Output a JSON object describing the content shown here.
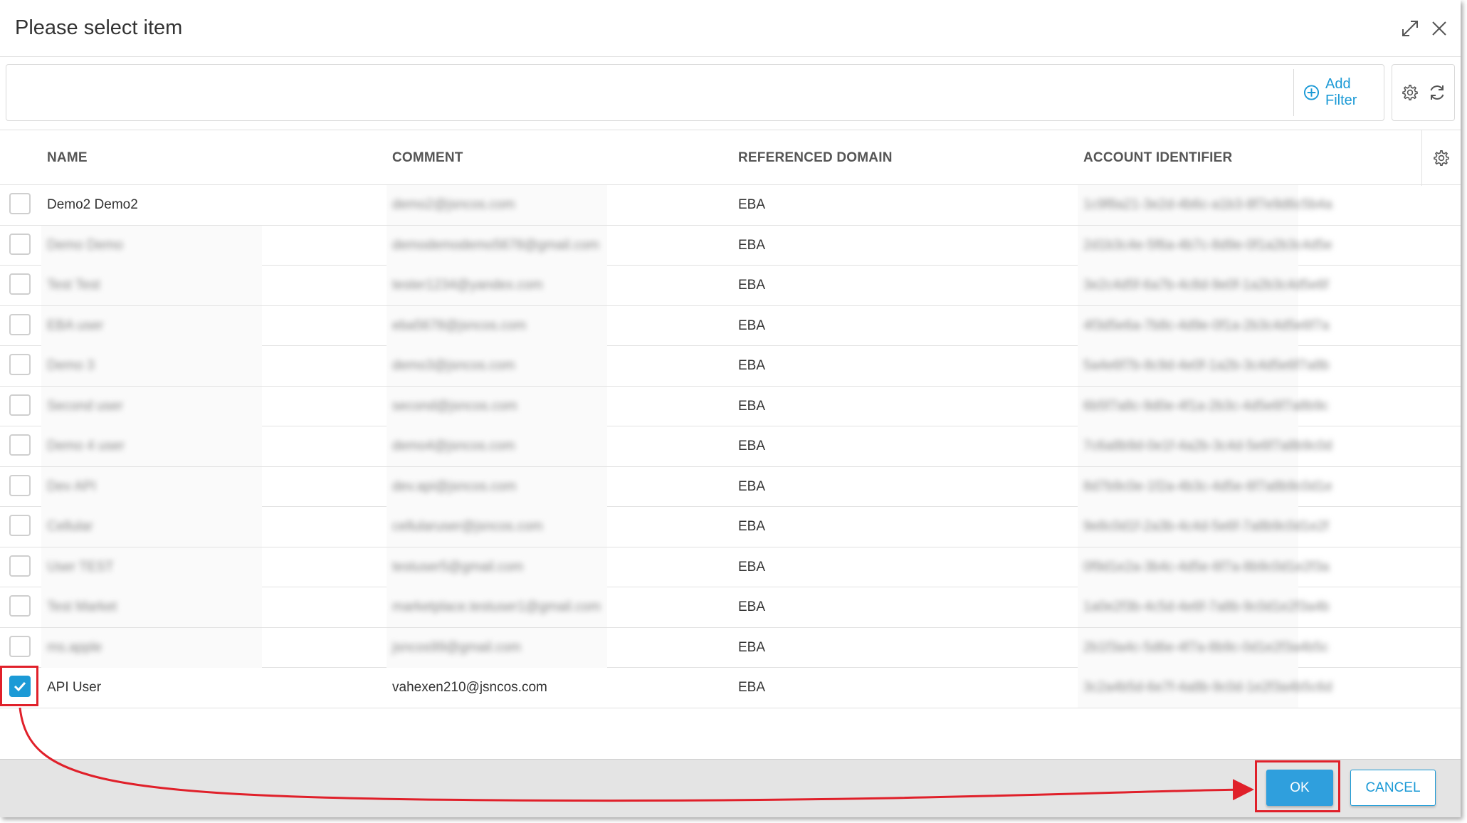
{
  "dialog": {
    "title": "Please select item",
    "icons": {
      "maximize": "expand-icon",
      "close": "close-icon"
    }
  },
  "filter": {
    "input_value": "",
    "add_filter_label": "Add Filter",
    "icons": {
      "add": "plus-circle-icon",
      "settings": "gear-icon",
      "refresh": "refresh-icon"
    }
  },
  "table": {
    "columns": [
      "NAME",
      "COMMENT",
      "REFERENCED DOMAIN",
      "ACCOUNT IDENTIFIER"
    ],
    "rows": [
      {
        "name": "Demo2 Demo2",
        "comment": "demo2@jsncos.com",
        "domain": "EBA",
        "account": "1c9f8a21-3e2d-4b6c-a1b3-8f7e9d6c5b4a",
        "checked": false,
        "blur_name": false,
        "blur_comment": true
      },
      {
        "name": "Demo Demo",
        "comment": "demodemodemo5678@gmail.com",
        "domain": "EBA",
        "account": "2d1b3c4e-5f6a-4b7c-8d9e-0f1a2b3c4d5e",
        "checked": false,
        "blur_name": true,
        "blur_comment": true
      },
      {
        "name": "Test Test",
        "comment": "tester1234@yandex.com",
        "domain": "EBA",
        "account": "3e2c4d5f-6a7b-4c8d-9e0f-1a2b3c4d5e6f",
        "checked": false,
        "blur_name": true,
        "blur_comment": true
      },
      {
        "name": "EBA user",
        "comment": "eba5678@jsncos.com",
        "domain": "EBA",
        "account": "4f3d5e6a-7b8c-4d9e-0f1a-2b3c4d5e6f7a",
        "checked": false,
        "blur_name": true,
        "blur_comment": true
      },
      {
        "name": "Demo 3",
        "comment": "demo3@jsncos.com",
        "domain": "EBA",
        "account": "5a4e6f7b-8c9d-4e0f-1a2b-3c4d5e6f7a8b",
        "checked": false,
        "blur_name": true,
        "blur_comment": true
      },
      {
        "name": "Second user",
        "comment": "second@jsncos.com",
        "domain": "EBA",
        "account": "6b5f7a8c-9d0e-4f1a-2b3c-4d5e6f7a8b9c",
        "checked": false,
        "blur_name": true,
        "blur_comment": true
      },
      {
        "name": "Demo 4 user",
        "comment": "demo4@jsncos.com",
        "domain": "EBA",
        "account": "7c6a8b9d-0e1f-4a2b-3c4d-5e6f7a8b9c0d",
        "checked": false,
        "blur_name": true,
        "blur_comment": true
      },
      {
        "name": "Dev API",
        "comment": "dev.api@jsncos.com",
        "domain": "EBA",
        "account": "8d7b9c0e-1f2a-4b3c-4d5e-6f7a8b9c0d1e",
        "checked": false,
        "blur_name": true,
        "blur_comment": true
      },
      {
        "name": "Cellular",
        "comment": "cellularuser@jsncos.com",
        "domain": "EBA",
        "account": "9e8c0d1f-2a3b-4c4d-5e6f-7a8b9c0d1e2f",
        "checked": false,
        "blur_name": true,
        "blur_comment": true
      },
      {
        "name": "User TEST",
        "comment": "testuser5@gmail.com",
        "domain": "EBA",
        "account": "0f9d1e2a-3b4c-4d5e-6f7a-8b9c0d1e2f3a",
        "checked": false,
        "blur_name": true,
        "blur_comment": true
      },
      {
        "name": "Test Market",
        "comment": "marketplace.testuser1@gmail.com",
        "domain": "EBA",
        "account": "1a0e2f3b-4c5d-4e6f-7a8b-9c0d1e2f3a4b",
        "checked": false,
        "blur_name": true,
        "blur_comment": true
      },
      {
        "name": "ms.apple",
        "comment": "jsncos99@gmail.com",
        "domain": "EBA",
        "account": "2b1f3a4c-5d6e-4f7a-8b9c-0d1e2f3a4b5c",
        "checked": false,
        "blur_name": true,
        "blur_comment": true
      },
      {
        "name": "API User",
        "comment": "vahexen210@jsncos.com",
        "domain": "EBA",
        "account": "3c2a4b5d-6e7f-4a8b-9c0d-1e2f3a4b5c6d",
        "checked": true,
        "blur_name": false,
        "blur_comment": false
      }
    ]
  },
  "footer": {
    "ok_label": "OK",
    "cancel_label": "CANCEL"
  },
  "colors": {
    "accent": "#1c9ad6",
    "ok_button": "#2f9fdd",
    "annotation": "#e0202a",
    "footer_bg": "#e4e4e4"
  }
}
